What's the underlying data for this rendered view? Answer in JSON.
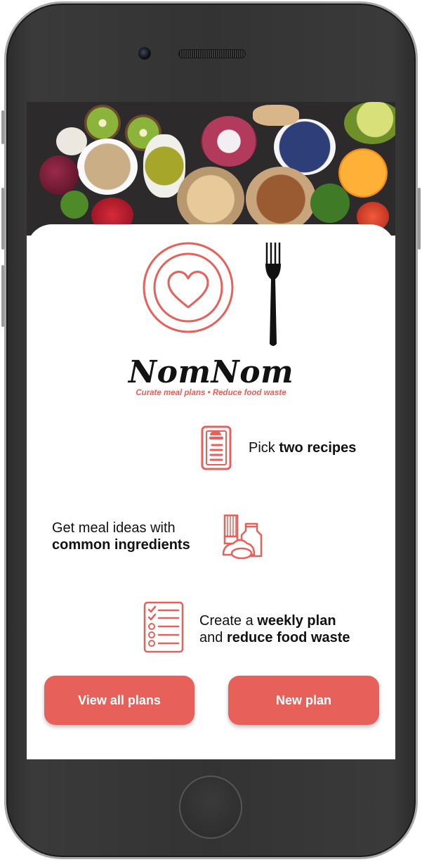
{
  "app": {
    "name": "NomNom",
    "tagline": "Curate meal plans • Reduce food waste"
  },
  "features": [
    {
      "text_regular": "Pick ",
      "text_bold": "two recipes",
      "icon": "recipe-card-icon"
    },
    {
      "text_regular": "Get meal ideas with",
      "text_bold": "common ingredients",
      "icon": "pantry-ingredients-icon"
    },
    {
      "text_regular_1": "Create a ",
      "text_bold_1": "weekly plan",
      "text_regular_2": "and ",
      "text_bold_2": "reduce food waste",
      "icon": "checklist-icon"
    }
  ],
  "buttons": {
    "view_all": "View all plans",
    "new_plan": "New plan"
  },
  "colors": {
    "accent": "#e8605a",
    "text": "#111111",
    "device_body": "#333333"
  },
  "hero": {
    "image": "fresh-food-assortment-photo"
  }
}
